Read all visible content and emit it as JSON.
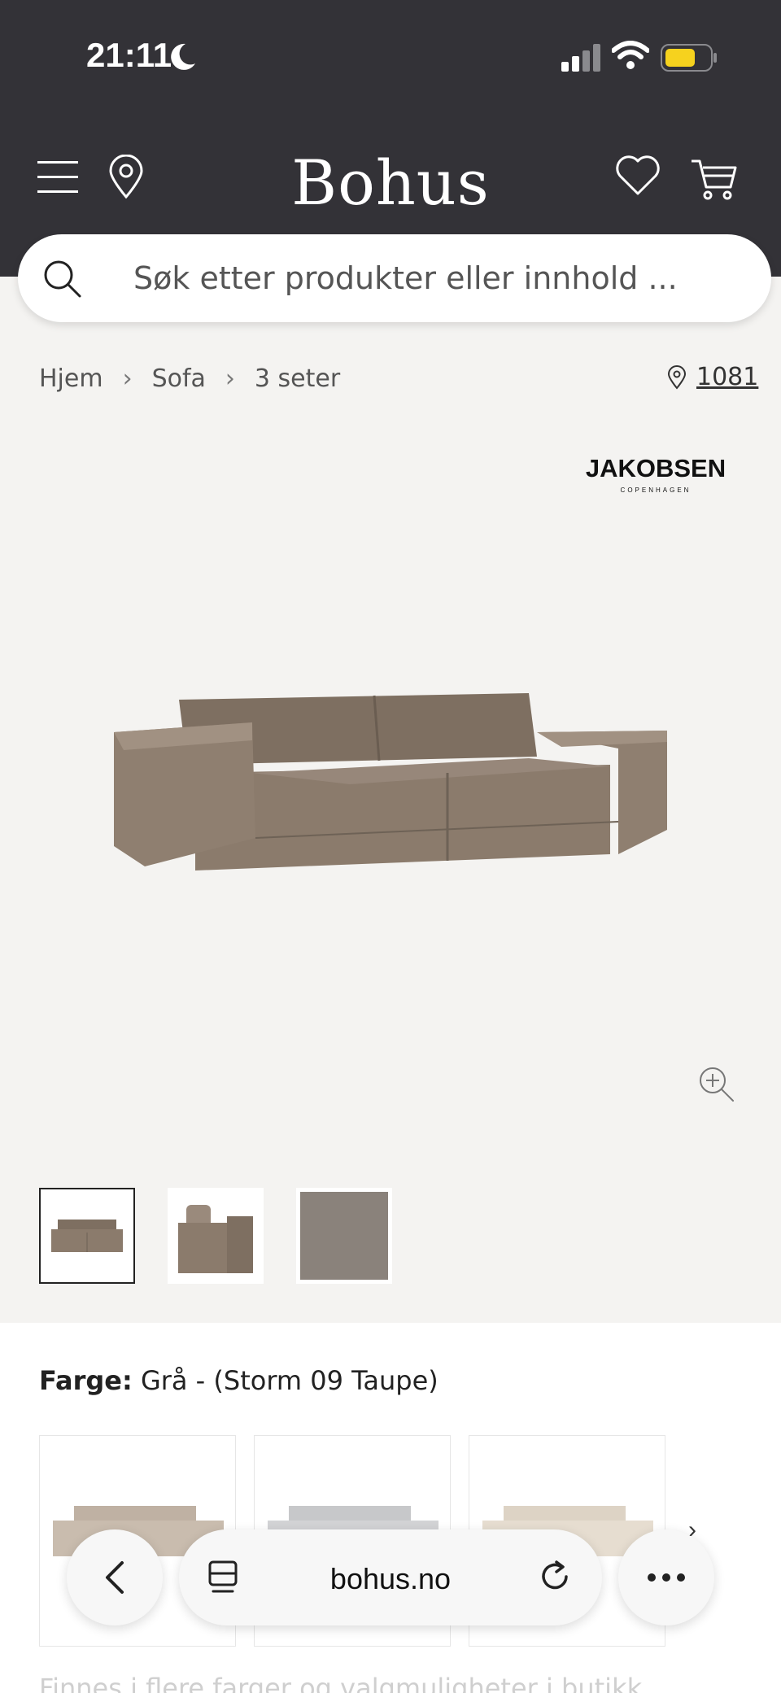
{
  "status_bar": {
    "time": "21:11"
  },
  "header": {
    "brand": "Bohus",
    "search_placeholder": "Søk etter produkter eller innhold ..."
  },
  "breadcrumb": {
    "items": [
      "Hjem",
      "Sofa",
      "3 seter"
    ]
  },
  "store": {
    "code": "1081"
  },
  "product": {
    "brand_logo": {
      "main": "JAKOBSEN",
      "sub": "COPENHAGEN"
    },
    "color_label": "Farge:",
    "color_value": "Grå - (Storm 09 Taupe)",
    "more_text": "Finnes i flere farger og valgmuligheter i butikk"
  },
  "browser": {
    "url": "bohus.no"
  },
  "colors": {
    "header_bg": "#333237",
    "page_bg": "#f4f3f1",
    "sofa": "#8b7b6c"
  }
}
